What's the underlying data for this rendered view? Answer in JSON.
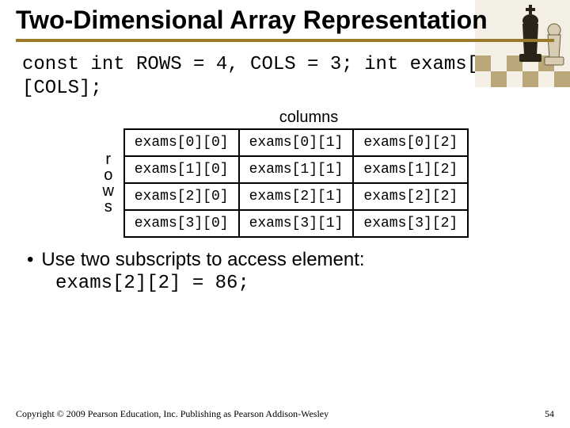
{
  "title": "Two-Dimensional Array Representation",
  "code_declaration": " const int ROWS = 4, COLS = 3; int exams[ROWS][COLS];",
  "columns_label": "columns",
  "rows_label_chars": [
    "r",
    "o",
    "w",
    "s"
  ],
  "chart_data": {
    "type": "table",
    "rows": [
      [
        "exams[0][0]",
        "exams[0][1]",
        "exams[0][2]"
      ],
      [
        "exams[1][0]",
        "exams[1][1]",
        "exams[1][2]"
      ],
      [
        "exams[2][0]",
        "exams[2][1]",
        "exams[2][2]"
      ],
      [
        "exams[3][0]",
        "exams[3][1]",
        "exams[3][2]"
      ]
    ]
  },
  "bullet_text": "Use two subscripts to access element:",
  "assignment_code": "exams[2][2] = 86;",
  "footer_copyright": "Copyright © 2009 Pearson Education, Inc. Publishing as Pearson Addison-Wesley",
  "page_number": "54"
}
